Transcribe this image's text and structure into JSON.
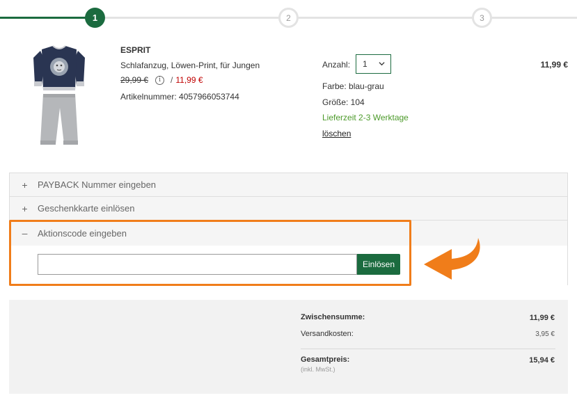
{
  "steps": {
    "step1": "1",
    "step2": "2",
    "step3": "3",
    "active_color": "#1b6b3f"
  },
  "product": {
    "brand": "ESPRIT",
    "name": "Schlafanzug, Löwen-Print, für Jungen",
    "old_price": "29,99 €",
    "price_separator": "/",
    "new_price": "11,99 €",
    "article_number": "Artikelnummer: 4057966053744",
    "quantity_label": "Anzahl:",
    "quantity_value": "1",
    "color": "Farbe: blau-grau",
    "size": "Größe: 104",
    "delivery": "Lieferzeit 2-3 Werktage",
    "delete_link": "löschen",
    "line_total": "11,99 €",
    "image_icon": "pajamas-image"
  },
  "accordion": {
    "payback": {
      "sign": "+",
      "label": "PAYBACK Nummer eingeben"
    },
    "giftcard": {
      "sign": "+",
      "label": "Geschenkkarte einlösen"
    },
    "promo": {
      "sign": "–",
      "label": "Aktionscode eingeben",
      "input_value": "",
      "button_label": "Einlösen"
    }
  },
  "highlight_color": "#f07d1a",
  "summary": {
    "subtotal_label": "Zwischensumme:",
    "subtotal_value": "11,99 €",
    "shipping_label": "Versandkosten:",
    "shipping_value": "3,95 €",
    "total_label": "Gesamtpreis:",
    "total_note": "(inkl. MwSt.)",
    "total_value": "15,94 €"
  }
}
